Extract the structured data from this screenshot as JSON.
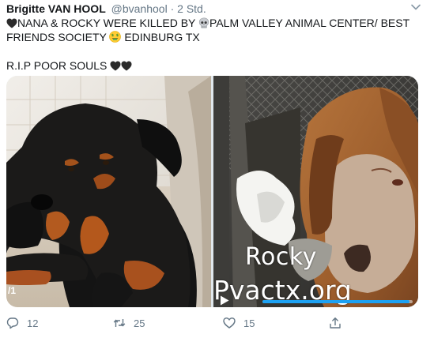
{
  "tweet": {
    "author_name": "Brigitte VAN HOOL",
    "handle": "@bvanhool",
    "separator": "·",
    "time": "2 Std.",
    "line1_a": "NANA & ROCKY WERE KILLED BY ",
    "line1_b": "PALM VALLEY ANIMAL CENTER/ BEST",
    "line2_a": "FRIENDS SOCIETY ",
    "line2_b": " EDINBURG TX",
    "line3": "R.I.P POOR SOULS ",
    "emoji": {
      "heart": "black-heart-icon",
      "skull": "skull-icon",
      "money": "money-mouth-face-icon"
    }
  },
  "media": {
    "counter": "/1",
    "watermark_name": "Rocky",
    "watermark_site": "Pvactx.org",
    "video_progress": 0.98
  },
  "actions": {
    "reply_count": "12",
    "retweet_count": "25",
    "like_count": "15"
  },
  "colors": {
    "text": "#14171a",
    "secondary": "#657786",
    "accent": "#1da1f2"
  }
}
